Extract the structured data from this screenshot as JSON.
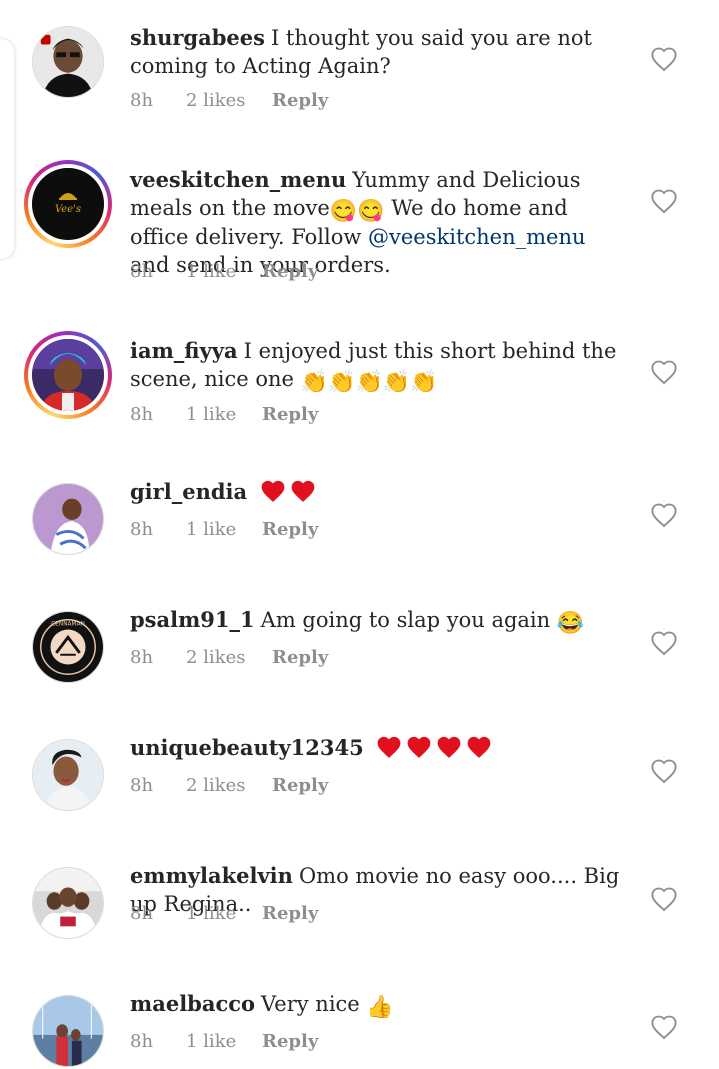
{
  "comments": [
    {
      "username": "shurgabees",
      "text": "I thought you said you are not coming to Acting Again?",
      "time": "8h",
      "likes": "2 likes",
      "reply": "Reply"
    },
    {
      "username": "veeskitchen_menu",
      "text_before": "Yummy and Delicious meals on the move",
      "text_middle": "We do home and office delivery. Follow",
      "mention": "@veeskitchen_menu",
      "text_after": "and send in your orders.",
      "emoji": "😋😋",
      "time": "8h",
      "likes": "1 like",
      "reply": "Reply"
    },
    {
      "username": "iam_fiyya",
      "text": "I enjoyed just this short behind the scene, nice one",
      "emoji": "👏👏👏👏👏",
      "time": "8h",
      "likes": "1 like",
      "reply": "Reply"
    },
    {
      "username": "girl_endia",
      "emoji": "❤❤",
      "time": "8h",
      "likes": "1 like",
      "reply": "Reply"
    },
    {
      "username": "psalm91_1",
      "text": "Am going to slap you again",
      "emoji": "😂",
      "time": "8h",
      "likes": "2 likes",
      "reply": "Reply"
    },
    {
      "username": "uniquebeauty12345",
      "emoji": "❤❤❤❤",
      "time": "8h",
      "likes": "2 likes",
      "reply": "Reply"
    },
    {
      "username": "emmylakelvin",
      "text": "Omo movie no easy ooo.... Big up Regina..",
      "time": "8h",
      "likes": "1 like",
      "reply": "Reply"
    },
    {
      "username": "maelbacco",
      "text": "Very nice",
      "emoji": "👍",
      "time": "8h",
      "likes": "1 like",
      "reply": "Reply"
    }
  ],
  "avatar_labels": {
    "vees": "Vee's",
    "cennaman": "CENNAMAN"
  },
  "icons": {
    "like": "heart-outline-icon"
  },
  "colors": {
    "text": "#262626",
    "meta": "#8e8e8e",
    "mention": "#00376b",
    "heart_red": "#e0101e"
  }
}
